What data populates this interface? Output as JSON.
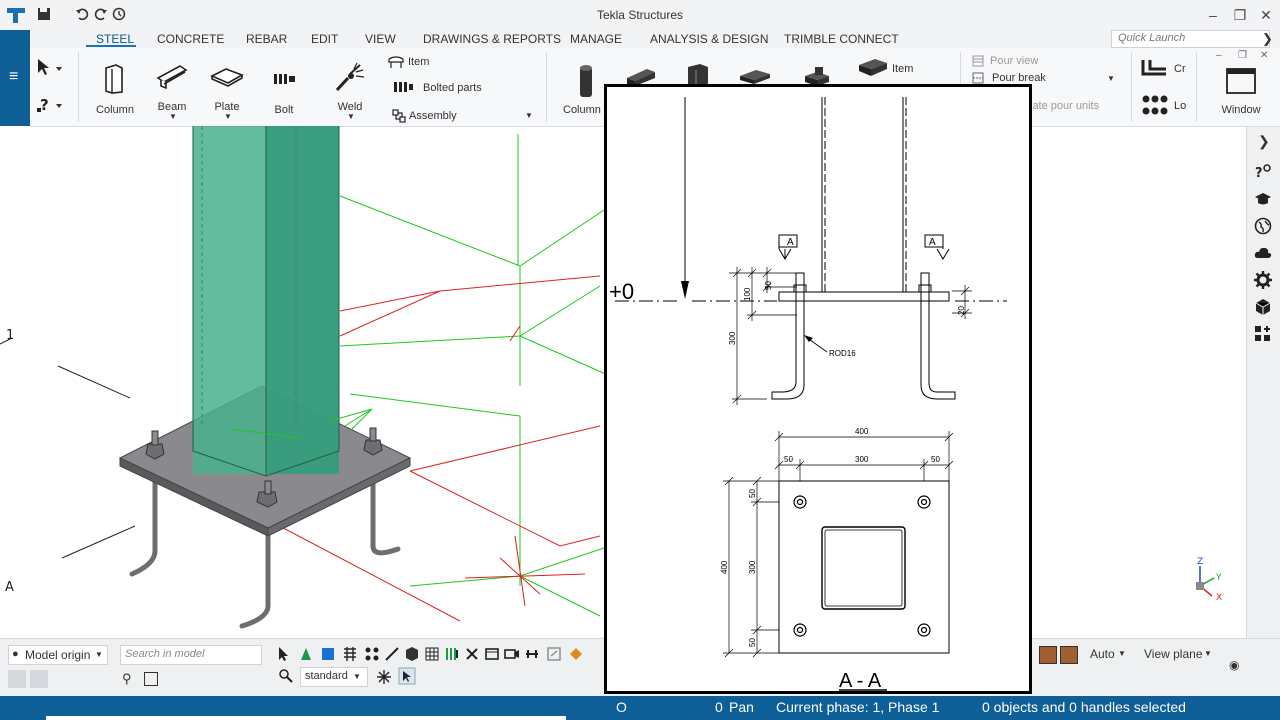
{
  "app": {
    "title": "Tekla Structures"
  },
  "tabs": [
    {
      "label": "STEEL"
    },
    {
      "label": "CONCRETE"
    },
    {
      "label": "REBAR"
    },
    {
      "label": "EDIT"
    },
    {
      "label": "VIEW"
    },
    {
      "label": "DRAWINGS & REPORTS"
    },
    {
      "label": "MANAGE"
    },
    {
      "label": "ANALYSIS & DESIGN"
    },
    {
      "label": "TRIMBLE CONNECT"
    }
  ],
  "quick_launch": {
    "placeholder": "Quick Launch"
  },
  "ribbon": {
    "column": "Column",
    "beam": "Beam",
    "plate": "Plate",
    "bolt": "Bolt",
    "weld": "Weld",
    "item": "Item",
    "bolted_parts": "Bolted parts",
    "assembly": "Assembly",
    "concrete_column": "Column",
    "concrete_item": "Item",
    "pour_view": "Pour view",
    "pour_break": "Pour break",
    "late_pour_units": "late pour units",
    "cr": "Cr",
    "lo": "Lo",
    "window": "Window"
  },
  "viewport": {
    "grid_label_1": "1",
    "grid_label_a": "A"
  },
  "drawing": {
    "level_label": "+0",
    "section_mark": "A",
    "section_title": "A - A",
    "rod_label": "ROD16",
    "dims": {
      "d50_top": "50",
      "d100": "100",
      "d300_anchor": "300",
      "d20": "20",
      "w400": "400",
      "w50_left": "50",
      "w300": "300",
      "w50_right": "50",
      "h50_top": "50",
      "h400": "400",
      "h300": "300",
      "h50_bottom": "50"
    }
  },
  "bottom": {
    "model_origin": "Model origin",
    "search_placeholder": "Search in model",
    "standard": "standard",
    "auto": "Auto",
    "view_plane": "View plane"
  },
  "status": {
    "o": "O",
    "pan_count": "0",
    "pan": "Pan",
    "phase": "Current phase: 1, Phase 1",
    "selection": "0 objects and 0 handles selected"
  },
  "colors": {
    "accent": "#0e5e97",
    "column": "#46b08c",
    "grid_red": "#e02020",
    "grid_green": "#1ec81e"
  }
}
